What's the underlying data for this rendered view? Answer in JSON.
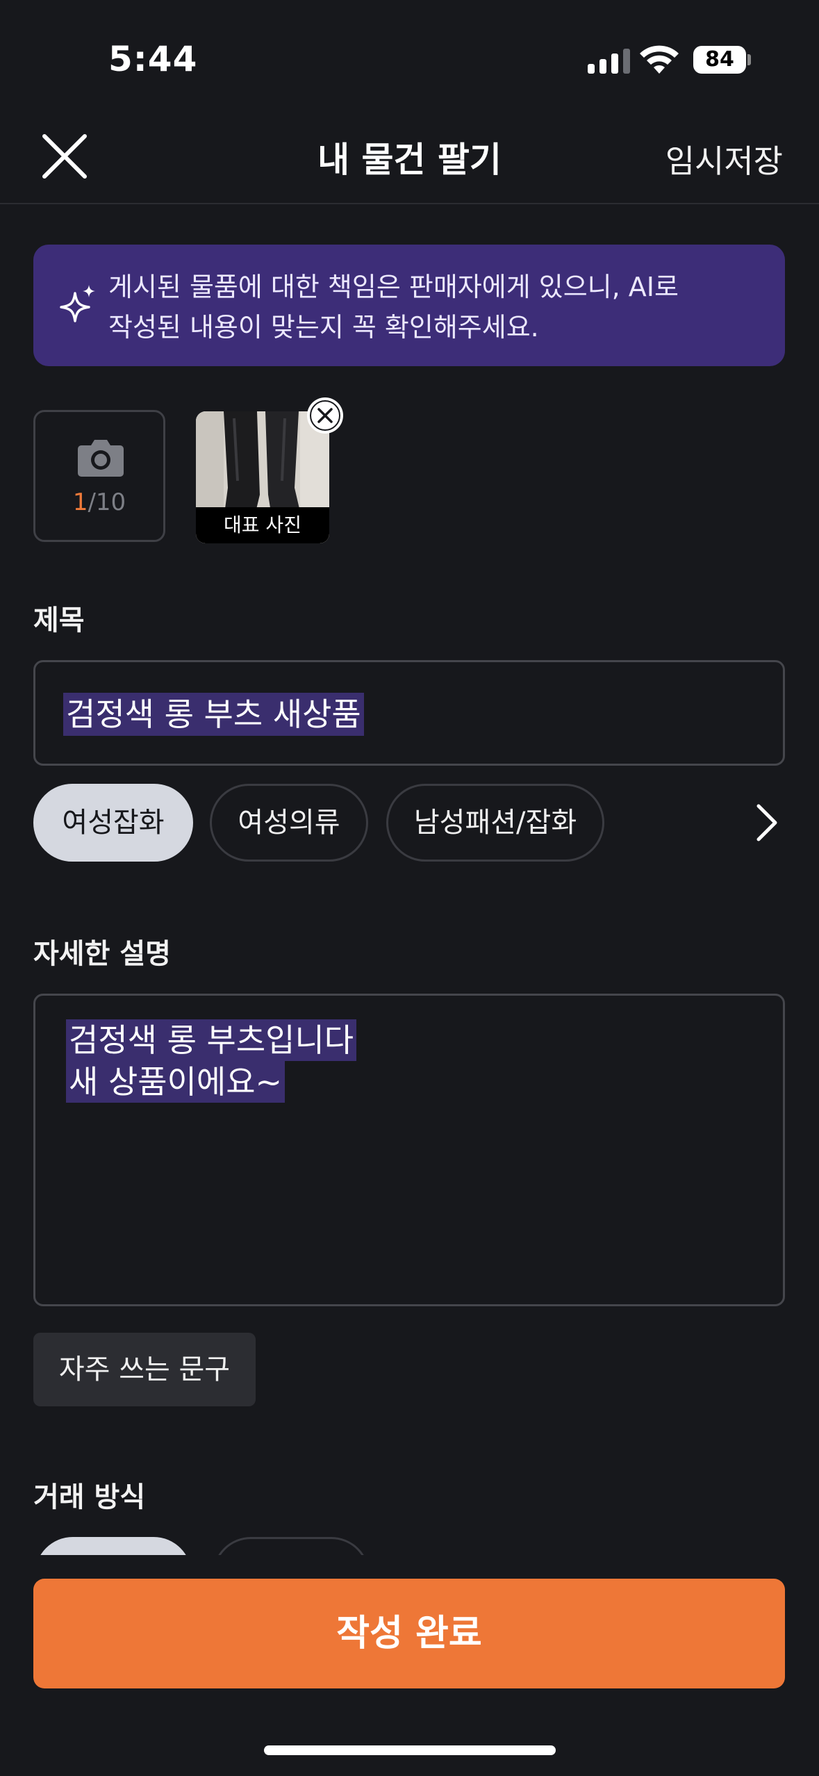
{
  "status_bar": {
    "time": "5:44",
    "battery": "84",
    "icons": [
      "signal-icon",
      "wifi-icon",
      "battery-icon"
    ]
  },
  "header": {
    "title": "내 물건 팔기",
    "temp_save": "임시저장",
    "close_icon": "close-icon"
  },
  "ai_notice": {
    "line1": "게시된 물품에 대한 책임은 판매자에게 있으니, AI로",
    "line2": "작성된 내용이 맞는지 꼭 확인해주세요.",
    "icon": "sparkle-icon"
  },
  "photos": {
    "count_current": "1",
    "count_total": "/10",
    "thumb_label": "대표 사진",
    "camera_icon": "camera-icon",
    "remove_icon": "close-icon"
  },
  "title_section": {
    "label": "제목",
    "value": "검정색 롱 부츠 새상품"
  },
  "categories": {
    "chips": [
      "여성잡화",
      "여성의류",
      "남성패션/잡화"
    ],
    "selected": "여성잡화",
    "next_icon": "chevron-right-icon"
  },
  "description_section": {
    "label": "자세한 설명",
    "lines": [
      "검정색 롱 부츠입니다",
      "새 상품이에요~"
    ]
  },
  "frequent_phrase_button": "자주 쓰는 문구",
  "trade_section": {
    "label": "거래 방식"
  },
  "submit_button": "작성 완료",
  "colors": {
    "background": "#17181c",
    "accent": "#ee7737",
    "notice": "#3d2d78",
    "selection_highlight": "#3a2e6e"
  }
}
